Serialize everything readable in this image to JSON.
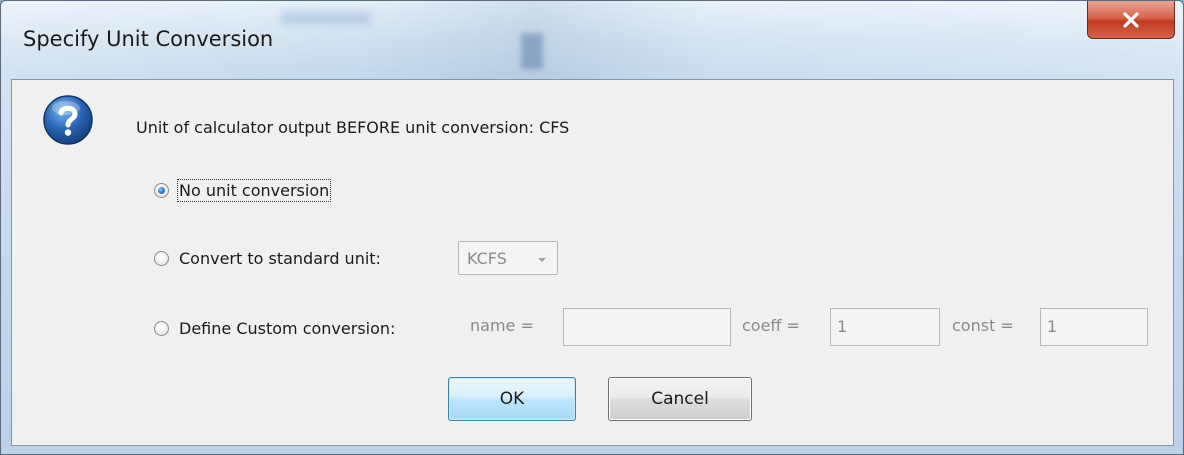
{
  "window": {
    "title": "Specify Unit Conversion"
  },
  "dialog": {
    "header": "Unit of calculator output BEFORE unit conversion: CFS",
    "icon": "question-icon"
  },
  "options": {
    "no_conversion": {
      "label": "No unit conversion",
      "selected": true
    },
    "standard": {
      "label": "Convert to standard unit:",
      "selected": false,
      "unit_value": "KCFS"
    },
    "custom": {
      "label": "Define Custom conversion:",
      "selected": false,
      "name_label": "name =",
      "name_value": "",
      "coeff_label": "coeff =",
      "coeff_value": "1",
      "const_label": "const =",
      "const_value": "1"
    }
  },
  "buttons": {
    "ok": "OK",
    "cancel": "Cancel"
  },
  "colors": {
    "close_button": "#c23b22",
    "ok_border": "#3c7fb1",
    "icon_blue": "#1f5aa6"
  }
}
